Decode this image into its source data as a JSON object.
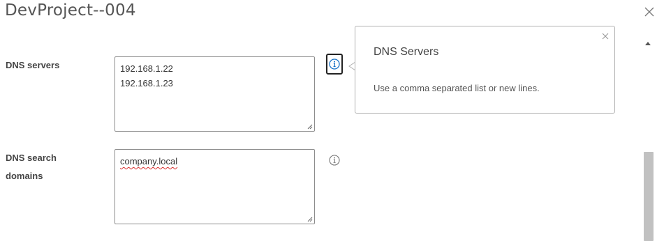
{
  "dialog": {
    "title": "DevProject--004",
    "close_icon": "close-icon"
  },
  "fields": {
    "dns_servers": {
      "label": "DNS servers",
      "lines": [
        "192.168.1.22",
        "192.168.1.23"
      ]
    },
    "dns_search_domains": {
      "label_line1": "DNS search",
      "label_line2": "domains",
      "value": "company.local"
    }
  },
  "popover": {
    "title": "DNS Servers",
    "body": "Use a comma separated list or new lines."
  },
  "icons": {
    "info": "info-icon",
    "resize_grip": "resize-grip-icon",
    "scroll_up": "chevron-up-icon"
  },
  "colors": {
    "info_active": "#1a73c7",
    "info_inactive": "#777777",
    "spellcheck": "#d93030",
    "scroll_thumb": "#c1c1c1"
  }
}
